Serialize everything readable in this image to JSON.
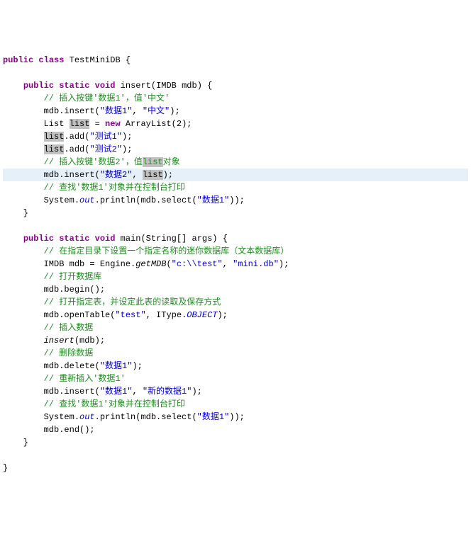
{
  "lines": {
    "l0_kw1": "public",
    "l0_kw2": "class",
    "l0_cls": "TestMiniDB",
    "l1_kw1": "public",
    "l1_kw2": "static",
    "l1_kw3": "void",
    "l1_method": "insert(IMDB mdb) {",
    "l2_cmt": "// 插入按键'数据1'，值'中文'",
    "l3_pre": "mdb.insert(",
    "l3_s1": "\"数据1\"",
    "l3_mid": ", ",
    "l3_s2": "\"中文\"",
    "l3_end": ");",
    "l4_pre": "List ",
    "l4_hl": "list",
    "l4_eq": " = ",
    "l4_kw": "new",
    "l4_rest": " ArrayList(2);",
    "l5_hl": "list",
    "l5_rest": ".add(",
    "l5_s": "\"测试1\"",
    "l5_end": ");",
    "l6_hl": "list",
    "l6_rest": ".add(",
    "l6_s": "\"测试2\"",
    "l6_end": ");",
    "l7_cmt_pre": "// 插入按键'数据2'，值",
    "l7_hl": "list",
    "l7_cmt_post": "对象",
    "l8_pre": "mdb.insert(",
    "l8_s": "\"数据2\"",
    "l8_mid": ", ",
    "l8_hl": "list",
    "l8_end": ");",
    "l9_cmt": "// 查找'数据1'对象并在控制台打印",
    "l10_pre": "System.",
    "l10_out": "out",
    "l10_mid": ".println(mdb.select(",
    "l10_s": "\"数据1\"",
    "l10_end": "));",
    "l11_kw1": "public",
    "l11_kw2": "static",
    "l11_kw3": "void",
    "l11_method": "main(String[] args) {",
    "l12_cmt": "// 在指定目录下设置一个指定名称的迷你数据库（文本数据库）",
    "l13_pre": "IMDB mdb = Engine.",
    "l13_m": "getMDB",
    "l13_p1": "(",
    "l13_s1": "\"c:\\\\test\"",
    "l13_mid": ", ",
    "l13_s2": "\"mini.db\"",
    "l13_end": ");",
    "l14_cmt": "// 打开数据库",
    "l15": "mdb.begin();",
    "l16_cmt": "// 打开指定表，并设定此表的读取及保存方式",
    "l17_pre": "mdb.openTable(",
    "l17_s": "\"test\"",
    "l17_mid": ", IType.",
    "l17_obj": "OBJECT",
    "l17_end": ");",
    "l18_cmt": "// 插入数据",
    "l19_m": "insert",
    "l19_rest": "(mdb);",
    "l20_cmt": "// 删除数据",
    "l21_pre": "mdb.delete(",
    "l21_s": "\"数据1\"",
    "l21_end": ");",
    "l22_cmt": "// 重新插入'数据1'",
    "l23_pre": "mdb.insert(",
    "l23_s1": "\"数据1\"",
    "l23_mid": ", ",
    "l23_s2": "\"新的数据1\"",
    "l23_end": ");",
    "l24_cmt": "// 查找'数据1'对象并在控制台打印",
    "l25_pre": "System.",
    "l25_out": "out",
    "l25_mid": ".println(mdb.select(",
    "l25_s": "\"数据1\"",
    "l25_end": "));",
    "l26": "mdb.end();"
  }
}
